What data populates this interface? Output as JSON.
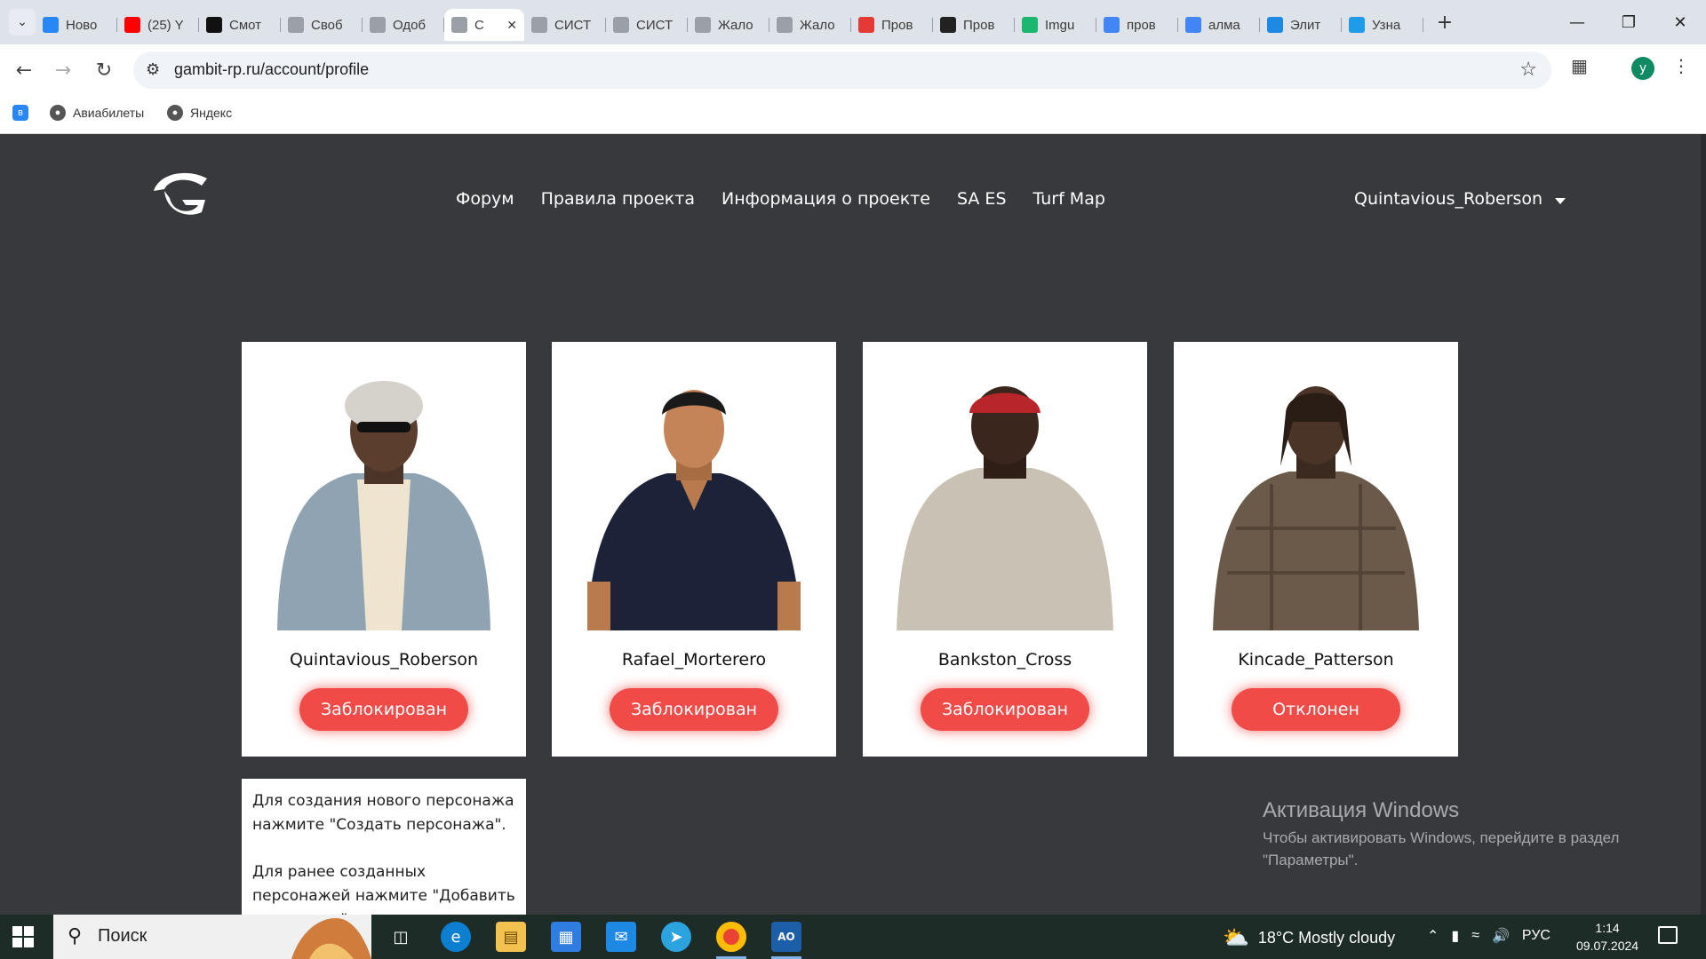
{
  "browser": {
    "tabs": [
      {
        "label": "Ново",
        "icon": "vk-icon",
        "color": "#2787f5"
      },
      {
        "label": "(25) Y",
        "icon": "youtube-icon",
        "color": "#ff0000"
      },
      {
        "label": "Смот",
        "icon": "hd-icon",
        "color": "#111111"
      },
      {
        "label": "Своб",
        "icon": "gambit-icon",
        "color": "#9aa0a6"
      },
      {
        "label": "Одоб",
        "icon": "gambit-icon",
        "color": "#9aa0a6"
      },
      {
        "label": "С",
        "icon": "gambit-icon",
        "color": "#9aa0a6",
        "active": true
      },
      {
        "label": "СИСТ",
        "icon": "gambit-icon",
        "color": "#9aa0a6"
      },
      {
        "label": "СИСТ",
        "icon": "gambit-icon",
        "color": "#9aa0a6"
      },
      {
        "label": "Жало",
        "icon": "gambit-icon",
        "color": "#9aa0a6"
      },
      {
        "label": "Жало",
        "icon": "gambit-icon",
        "color": "#9aa0a6"
      },
      {
        "label": "Пров",
        "icon": "copyright-icon",
        "color": "#e53935"
      },
      {
        "label": "Пров",
        "icon": "ut-icon",
        "color": "#222222"
      },
      {
        "label": "Imgu",
        "icon": "imgur-icon",
        "color": "#1bb76e"
      },
      {
        "label": "пров",
        "icon": "google-icon",
        "color": "#4285f4"
      },
      {
        "label": "алма",
        "icon": "google-icon",
        "color": "#4285f4"
      },
      {
        "label": "Элит",
        "icon": "edge-icon",
        "color": "#1e88e5"
      },
      {
        "label": "Узна",
        "icon": "ip-icon",
        "color": "#1e9be9"
      }
    ],
    "url": "gambit-rp.ru/account/profile",
    "profile_initial": "y",
    "bookmarks": [
      {
        "label": "",
        "icon": "vk-icon"
      },
      {
        "label": "Авиабилеты",
        "icon": "globe-icon"
      },
      {
        "label": "Яндекс",
        "icon": "globe-icon"
      }
    ]
  },
  "site": {
    "nav": [
      "Форум",
      "Правила проекта",
      "Информация о проекте",
      "SA ES",
      "Turf Map"
    ],
    "user": "Quintavious_Roberson",
    "characters": [
      {
        "name": "Quintavious_Roberson",
        "status": "Заблокирован"
      },
      {
        "name": "Rafael_Morterero",
        "status": "Заблокирован"
      },
      {
        "name": "Bankston_Cross",
        "status": "Заблокирован"
      },
      {
        "name": "Kincade_Patterson",
        "status": "Отклонен"
      }
    ],
    "info": {
      "line1": "Для создания нового персонажа нажмите \"Создать персонажа\".",
      "line2": "Для ранее созданных персонажей нажмите \"Добавить персонажа\"."
    },
    "accent": "#f14b48"
  },
  "watermark": {
    "title": "Активация Windows",
    "line1": "Чтобы активировать Windows, перейдите в раздел",
    "line2": "\"Параметры\"."
  },
  "taskbar": {
    "search": "Поиск",
    "weather": "18°C  Mostly cloudy",
    "lang": "РУС",
    "time": "1:14",
    "date": "09.07.2024"
  }
}
